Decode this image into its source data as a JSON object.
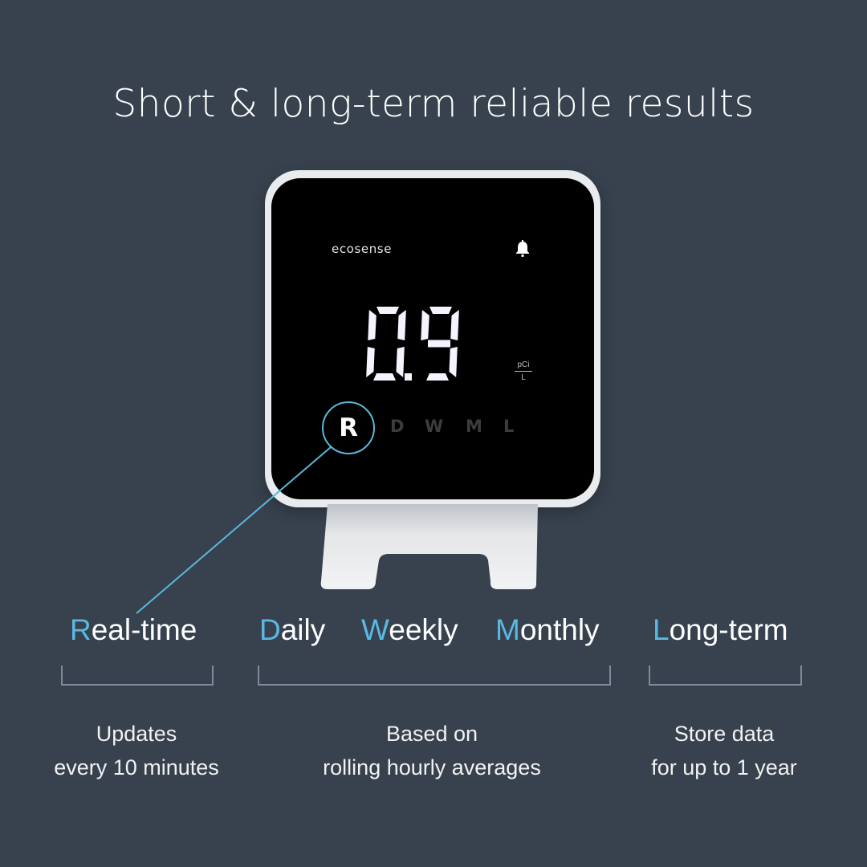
{
  "title": "Short & long-term reliable results",
  "device": {
    "brand": "ecosense",
    "alert_icon": "bell-icon",
    "reading": "0.91",
    "unit_top": "pCi",
    "unit_bottom": "L",
    "modes": [
      {
        "letter": "R",
        "active": true
      },
      {
        "letter": "D",
        "active": false
      },
      {
        "letter": "W",
        "active": false
      },
      {
        "letter": "M",
        "active": false
      },
      {
        "letter": "L",
        "active": false
      }
    ]
  },
  "colors": {
    "background": "#37424e",
    "accent": "#5ab8e4",
    "bracket": "#7f8b98"
  },
  "features": {
    "realtime": {
      "initial": "R",
      "rest": "eal-time",
      "desc": [
        "Updates",
        "every 10 minutes"
      ]
    },
    "rolling": {
      "labels": [
        {
          "initial": "D",
          "rest": "aily"
        },
        {
          "initial": "W",
          "rest": "eekly"
        },
        {
          "initial": "M",
          "rest": "onthly"
        }
      ],
      "desc": [
        "Based on",
        "rolling hourly averages"
      ]
    },
    "longterm": {
      "initial": "L",
      "rest": "ong-term",
      "desc": [
        "Store data",
        "for up to 1 year"
      ]
    }
  }
}
